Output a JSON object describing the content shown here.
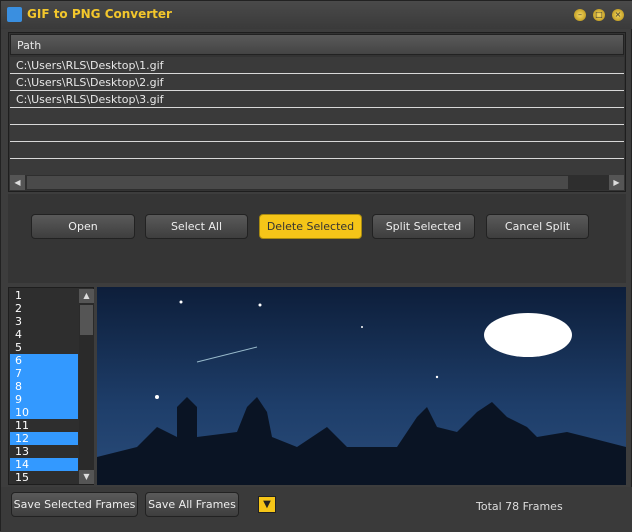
{
  "window": {
    "title": "GIF to PNG Converter"
  },
  "table": {
    "header": "Path",
    "rows": [
      "C:\\Users\\RLS\\Desktop\\1.gif",
      "C:\\Users\\RLS\\Desktop\\2.gif",
      "C:\\Users\\RLS\\Desktop\\3.gif"
    ]
  },
  "buttons": {
    "open": "Open",
    "select_all": "Select All",
    "delete_selected": "Delete Selected",
    "split_selected": "Split Selected",
    "cancel_split": "Cancel Split"
  },
  "frames": {
    "items": [
      "1",
      "2",
      "3",
      "4",
      "5",
      "6",
      "7",
      "8",
      "9",
      "10",
      "11",
      "12",
      "13",
      "14",
      "15"
    ],
    "selected": [
      "6",
      "7",
      "8",
      "9",
      "10",
      "12",
      "14"
    ]
  },
  "bottom": {
    "save_selected": "Save Selected Frames",
    "save_all": "Save All Frames",
    "total": "Total 78 Frames"
  },
  "colors": {
    "accent": "#f5c518",
    "selection": "#3399ff"
  }
}
